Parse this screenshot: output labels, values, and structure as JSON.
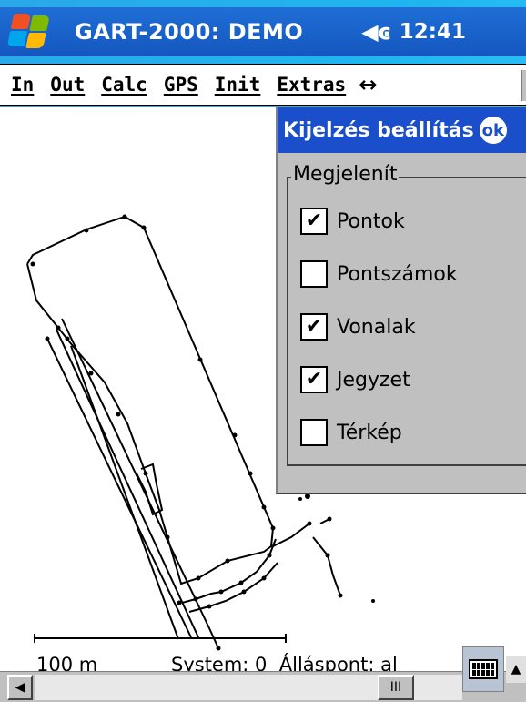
{
  "titlebar": {
    "app_title": "GART-2000: DEMO",
    "time": "12:41",
    "start_icon": "windows-flag-icon",
    "volume_icon": "speaker-icon"
  },
  "menu": {
    "items": [
      "In",
      "Out",
      "Calc",
      "GPS",
      "Init",
      "Extras"
    ],
    "extra_icon": "double-arrow-icon"
  },
  "map": {
    "scale_label": "100 m",
    "status_text": "System: 0  Álláspont: al"
  },
  "dialog": {
    "title": "Kijelzés beállítás",
    "ok_label": "ok",
    "group_label": "Megjelenít",
    "options": [
      {
        "label": "Pontok",
        "checked": true
      },
      {
        "label": "Pontszámok",
        "checked": false
      },
      {
        "label": "Vonalak",
        "checked": true
      },
      {
        "label": "Jegyzet",
        "checked": true
      },
      {
        "label": "Térkép",
        "checked": false
      }
    ]
  },
  "bottom": {
    "scroll_left_icon": "triangle-left-icon",
    "scroll_thumb_glyph": "III",
    "sip_arrow": "▲"
  },
  "colors": {
    "titlebar": "#1556c0",
    "dialog_title": "#1a4ecb",
    "background": "#1fb6f0"
  }
}
